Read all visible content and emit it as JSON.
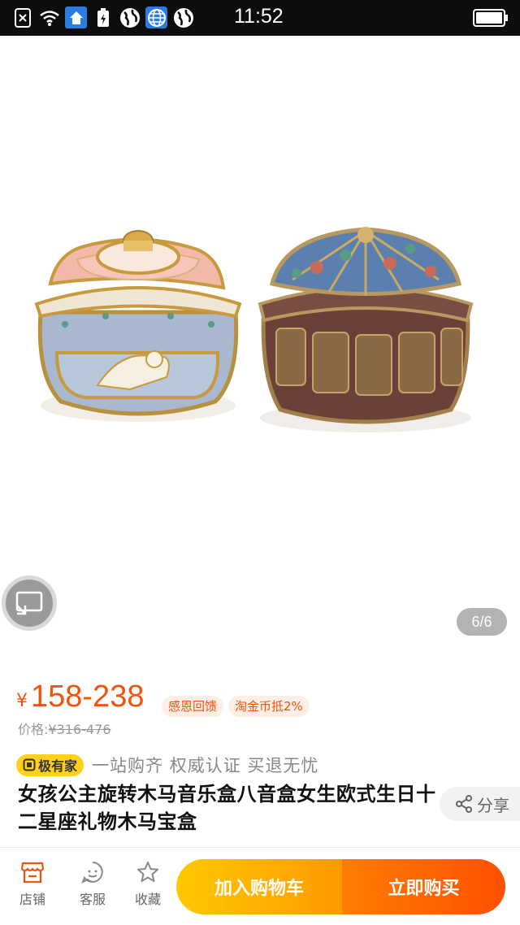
{
  "status_bar": {
    "time": "11:52",
    "icons": [
      "sim-disabled-icon",
      "wifi-icon",
      "home-icon",
      "battery-saver-icon",
      "globe-icon",
      "globe-icon",
      "globe-icon"
    ]
  },
  "product": {
    "image_pager": "6/6",
    "price_symbol": "¥",
    "price": "158-238",
    "tags": [
      "感恩回馈",
      "淘金币抵2%"
    ],
    "original_price_label": "价格:",
    "original_price": "¥316-476",
    "brand_badge": "极有家",
    "brand_slogan": "一站购齐 权威认证 买退无忧",
    "title": "女孩公主旋转木马音乐盒八音盒女生欧式生日十二星座礼物木马宝盒",
    "share_label": "分享"
  },
  "bottom_bar": {
    "store_label": "店铺",
    "service_label": "客服",
    "favorite_label": "收藏",
    "add_to_cart_label": "加入购物车",
    "buy_now_label": "立即购买"
  },
  "colors": {
    "accent": "#f0540c",
    "cart_gradient": [
      "#ffc800",
      "#ff9a00"
    ],
    "buy_gradient": [
      "#ff7d00",
      "#ff5000"
    ],
    "brand_badge": "#ffd11a"
  }
}
